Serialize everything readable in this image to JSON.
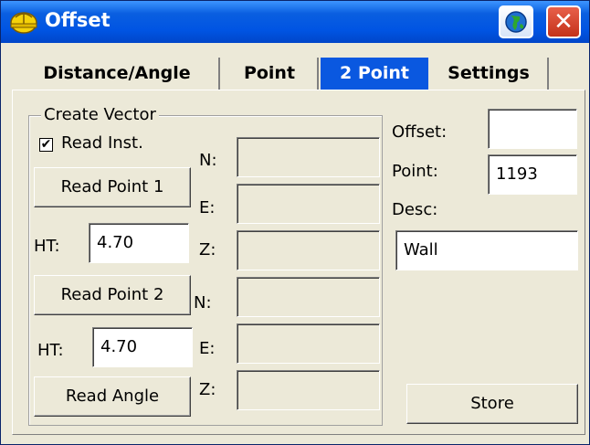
{
  "window": {
    "title": "Offset"
  },
  "tabs": [
    "Distance/Angle",
    "Point",
    "2 Point",
    "Settings"
  ],
  "active_tab": "2 Point",
  "group": {
    "label": "Create Vector"
  },
  "read_inst": {
    "label": "Read Inst.",
    "checked": true
  },
  "buttons": {
    "read_point_1": "Read Point 1",
    "read_point_2": "Read Point 2",
    "read_angle": "Read Angle",
    "store": "Store"
  },
  "ht1": {
    "label": "HT:",
    "value": "4.70"
  },
  "ht2": {
    "label": "HT:",
    "value": "4.70"
  },
  "coord_labels": {
    "n": "N:",
    "e": "E:",
    "z": "Z:"
  },
  "right": {
    "offset_label": "Offset:",
    "offset_value": "",
    "point_label": "Point:",
    "point_value": "1193",
    "desc_label": "Desc:",
    "desc_value": "Wall"
  },
  "icons": {
    "app": "hardhat-icon",
    "globe": "globe-icon",
    "close": "close-icon"
  }
}
